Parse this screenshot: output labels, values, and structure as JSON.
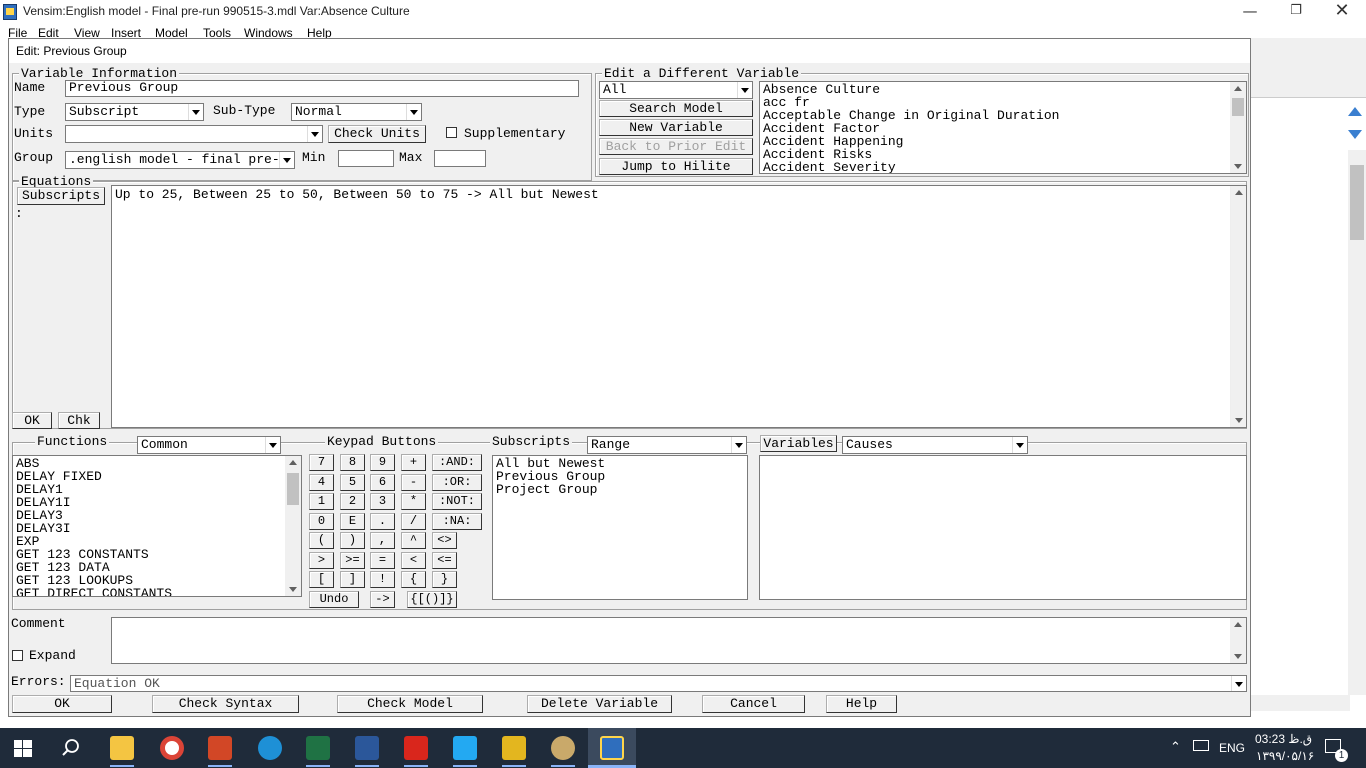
{
  "window": {
    "title": "Vensim:English model - Final pre-run 990515-3.mdl Var:Absence Culture",
    "menu": [
      "File",
      "Edit",
      "View",
      "Insert",
      "Model",
      "Tools",
      "Windows",
      "Help"
    ]
  },
  "dialog": {
    "title": "Edit: Previous Group",
    "var_info": {
      "title": "Variable Information",
      "name_label": "Name",
      "name_value": "Previous Group",
      "type_label": "Type",
      "type_value": "Subscript",
      "subtype_label": "Sub-Type",
      "subtype_value": "Normal",
      "units_label": "Units",
      "units_value": "",
      "check_units": "Check Units",
      "supplementary": "Supplementary",
      "group_label": "Group",
      "group_value": ".english model - final pre-",
      "min_label": "Min",
      "max_label": "Max",
      "min_value": "",
      "max_value": ""
    },
    "edit_diff": {
      "title": "Edit a Different Variable",
      "filter_value": "All",
      "search_model": "Search Model",
      "new_variable": "New Variable",
      "back_prior": "Back to Prior Edit",
      "jump_hilite": "Jump to Hilite",
      "variables": [
        "Absence Culture",
        "acc fr",
        "Acceptable Change in Original Duration",
        "Accident Factor",
        "Accident Happening",
        "Accident Risks",
        "Accident Severity"
      ]
    },
    "equations": {
      "title": "Equations",
      "subscripts_btn": "Subscripts",
      "colon": ":",
      "text": "Up to 25, Between 25 to 50, Between 50 to 75 -> All but Newest",
      "ok": "OK",
      "chk": "Chk"
    },
    "functions": {
      "title": "Functions",
      "category": "Common",
      "items": [
        "ABS",
        "DELAY FIXED",
        "DELAY1",
        "DELAY1I",
        "DELAY3",
        "DELAY3I",
        "EXP",
        "GET 123 CONSTANTS",
        "GET 123 DATA",
        "GET 123 LOOKUPS",
        "GET DIRECT CONSTANTS"
      ]
    },
    "keypad": {
      "title": "Keypad Buttons",
      "rows": [
        [
          "7",
          "8",
          "9",
          "+",
          ":AND:"
        ],
        [
          "4",
          "5",
          "6",
          "-",
          ":OR:"
        ],
        [
          "1",
          "2",
          "3",
          "*",
          ":NOT:"
        ],
        [
          "0",
          "E",
          ".",
          "/",
          ":NA:"
        ],
        [
          "(",
          ")",
          ",",
          "^",
          "<>"
        ],
        [
          ">",
          ">=",
          "=",
          "<",
          "<="
        ],
        [
          "[",
          "]",
          "!",
          "{",
          "}"
        ]
      ],
      "undo": "Undo",
      "arrow": "->",
      "brackets": "{[()]}"
    },
    "subscripts": {
      "title": "Subscripts",
      "mode": "Range",
      "items": [
        "All but Newest",
        "Previous Group",
        "Project Group"
      ]
    },
    "variables_panel": {
      "button": "Variables",
      "mode": "Causes"
    },
    "comment": {
      "label": "Comment",
      "expand": "Expand",
      "text": ""
    },
    "errors": {
      "label": "Errors:",
      "text": "Equation OK"
    },
    "bottom_buttons": {
      "ok": "OK",
      "check_syntax": "Check Syntax",
      "check_model": "Check Model",
      "delete_variable": "Delete Variable",
      "cancel": "Cancel",
      "help": "Help"
    }
  },
  "taskbar": {
    "icons": [
      "windows-start-icon",
      "search-icon",
      "file-explorer-icon",
      "chrome-icon",
      "powerpoint-icon",
      "edge-icon",
      "excel-icon",
      "word-icon",
      "acrobat-icon",
      "vscode-icon",
      "app-icon-1",
      "app-icon-2",
      "vensim-icon"
    ],
    "lang": "ENG",
    "time": "03:23 ق.ظ",
    "date": "۱۳۹۹/۰۵/۱۶",
    "notif_count": "1"
  }
}
